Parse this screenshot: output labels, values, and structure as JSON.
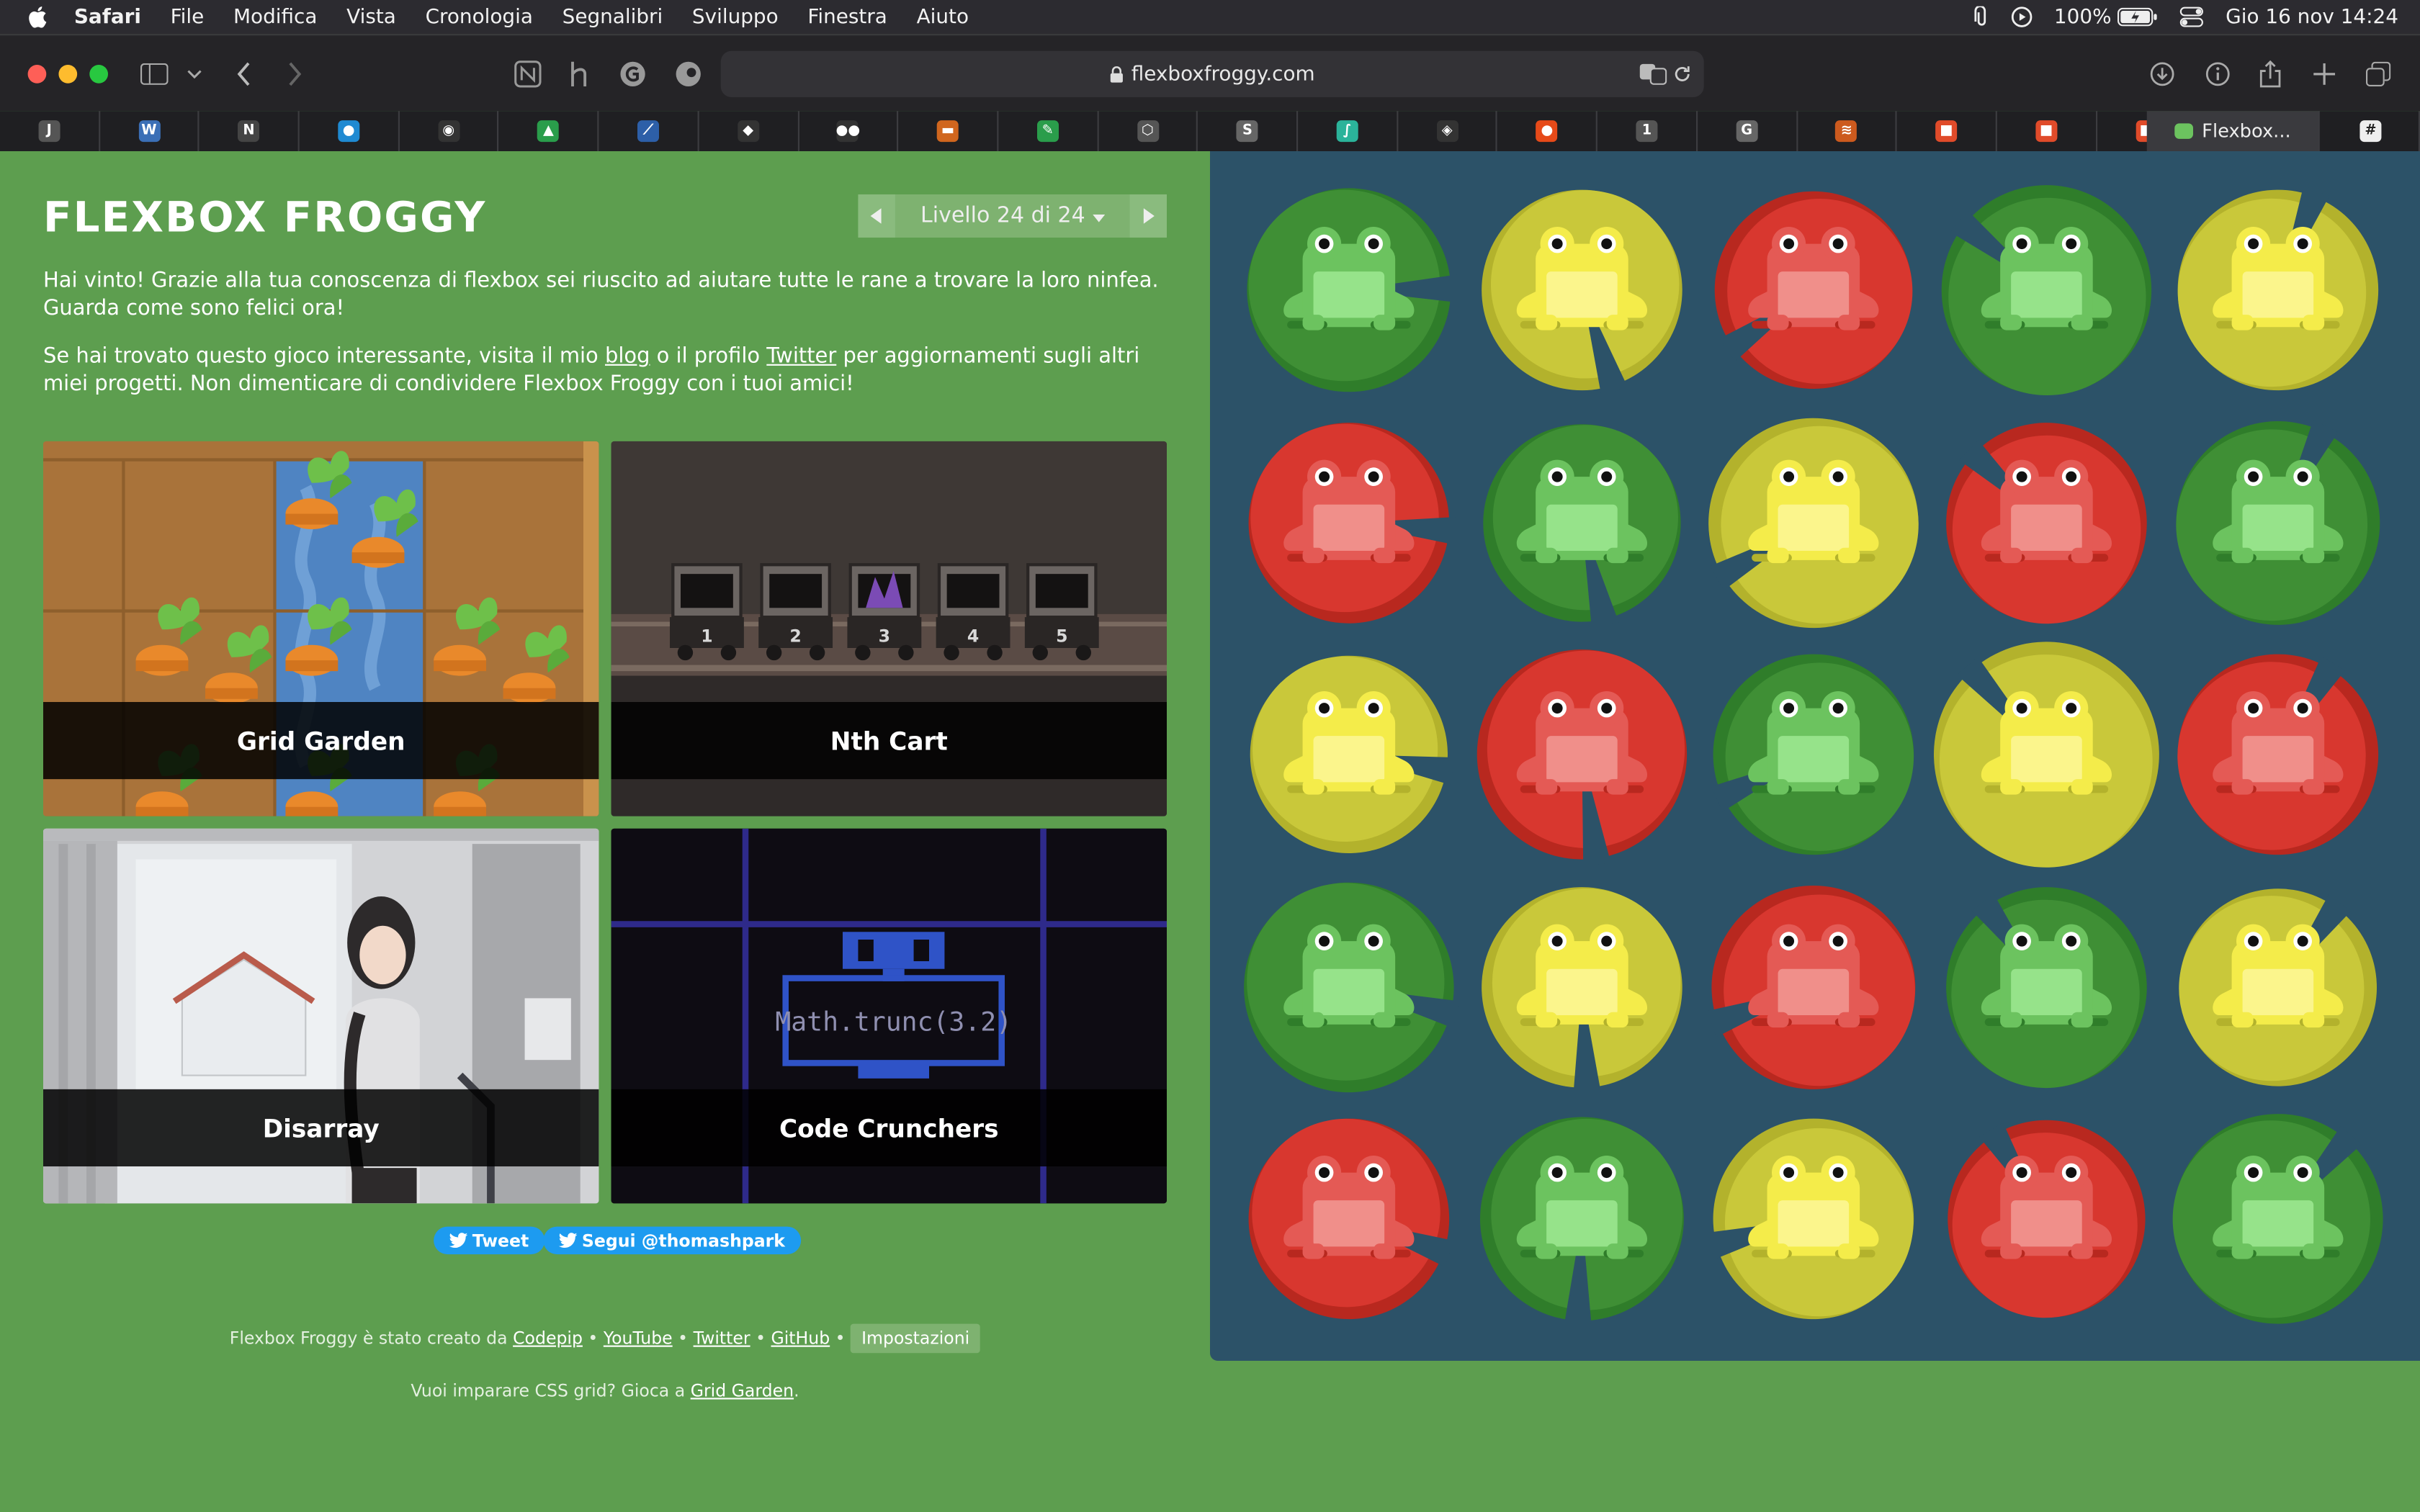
{
  "menubar": {
    "app": "Safari",
    "items": [
      "File",
      "Modifica",
      "Vista",
      "Cronologia",
      "Segnalibri",
      "Sviluppo",
      "Finestra",
      "Aiuto"
    ],
    "battery": "100%",
    "datetime": "Gio 16 nov  14:24"
  },
  "toolbar": {
    "url": "flexboxfroggy.com"
  },
  "tabs": {
    "favicons": [
      "J",
      "W",
      "N",
      "●",
      "◉",
      "▲",
      "⟋",
      "◆",
      "●●",
      "▬",
      "✎",
      "⬡",
      "S",
      "∫",
      "◈",
      "●",
      "1",
      "G",
      "≋",
      "■",
      "■",
      "■"
    ],
    "active_label": "Flexbox..."
  },
  "page": {
    "title": "FLEXBOX FROGGY",
    "level_label": "Livello 24 di 24",
    "para1": "Hai vinto! Grazie alla tua conoscenza di flexbox sei riuscito ad aiutare tutte le rane a trovare la loro ninfea. Guarda come sono felici ora!",
    "para2_a": "Se hai trovato questo gioco interessante, visita il mio ",
    "para2_blog": "blog",
    "para2_b": " o il profilo ",
    "para2_twitter": "Twitter",
    "para2_c": " per aggiornamenti sugli altri miei progetti. Non dimenticare di condividere Flexbox Froggy con i tuoi amici!",
    "cards": [
      "Grid Garden",
      "Nth Cart",
      "Disarray",
      "Code Crunchers"
    ],
    "cart_numbers": [
      "1",
      "2",
      "3",
      "4",
      "5"
    ],
    "code_text": "Math.trunc(3.2)",
    "tweet": "Tweet",
    "follow": "Segui @thomashpark",
    "footer_a": "Flexbox Froggy è stato creato da ",
    "footer_codepip": "Codepip",
    "footer_youtube": "YouTube",
    "footer_twitter": "Twitter",
    "footer_github": "GitHub",
    "footer_settings": "Impostazioni",
    "footer2_a": "Vuoi imparare CSS grid? Gioca a ",
    "footer2_link": "Grid Garden",
    "footer2_b": "."
  },
  "board": {
    "rows": [
      [
        "green",
        "yellow",
        "red",
        "green",
        "yellow"
      ],
      [
        "red",
        "green",
        "yellow",
        "red",
        "green"
      ],
      [
        "yellow",
        "red",
        "green",
        "yellow",
        "red"
      ],
      [
        "green",
        "yellow",
        "red",
        "green",
        "yellow"
      ],
      [
        "red",
        "green",
        "yellow",
        "red",
        "green"
      ]
    ],
    "colors": {
      "green": {
        "pad": "#3f8f35",
        "dark": "#2f7d2a",
        "frog": "#6cc35f",
        "light": "#96e38a"
      },
      "yellow": {
        "pad": "#c9c83a",
        "dark": "#b3b22c",
        "frog": "#f4ec4a",
        "light": "#fbf58c"
      },
      "red": {
        "pad": "#d8372f",
        "dark": "#b8281f",
        "frog": "#e45a55",
        "light": "#f08f8a"
      }
    }
  }
}
